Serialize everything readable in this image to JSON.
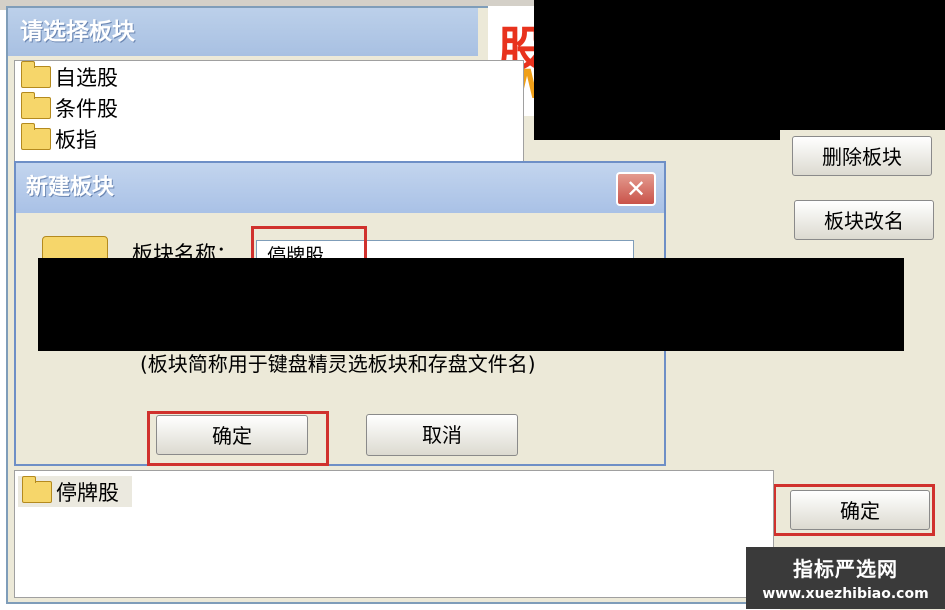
{
  "outer_dialog": {
    "title": "请选择板块",
    "tree_items": [
      "自选股",
      "条件股",
      "板指"
    ],
    "buttons": {
      "delete_board": "删除板块",
      "rename_board": "板块改名",
      "ok": "确定"
    },
    "lower_list": [
      "停牌股"
    ]
  },
  "new_board_dialog": {
    "title": "新建板块",
    "close_symbol": "✕",
    "name_label": "板块名称：",
    "name_value": "停牌股",
    "hint": "(板块简称用于键盘精灵选板块和存盘文件名)",
    "ok_label": "确定",
    "cancel_label": "取消"
  },
  "watermark": {
    "line1": "指标严选网",
    "line2": "www.xuezhibiao.com"
  },
  "colors": {
    "highlight_frame": "#d0312d",
    "titlebar": "#a9c1e6",
    "dialog_bg": "#ece9d8",
    "folder": "#f6d66a"
  },
  "icons": [
    "folder-icon",
    "close-icon"
  ]
}
